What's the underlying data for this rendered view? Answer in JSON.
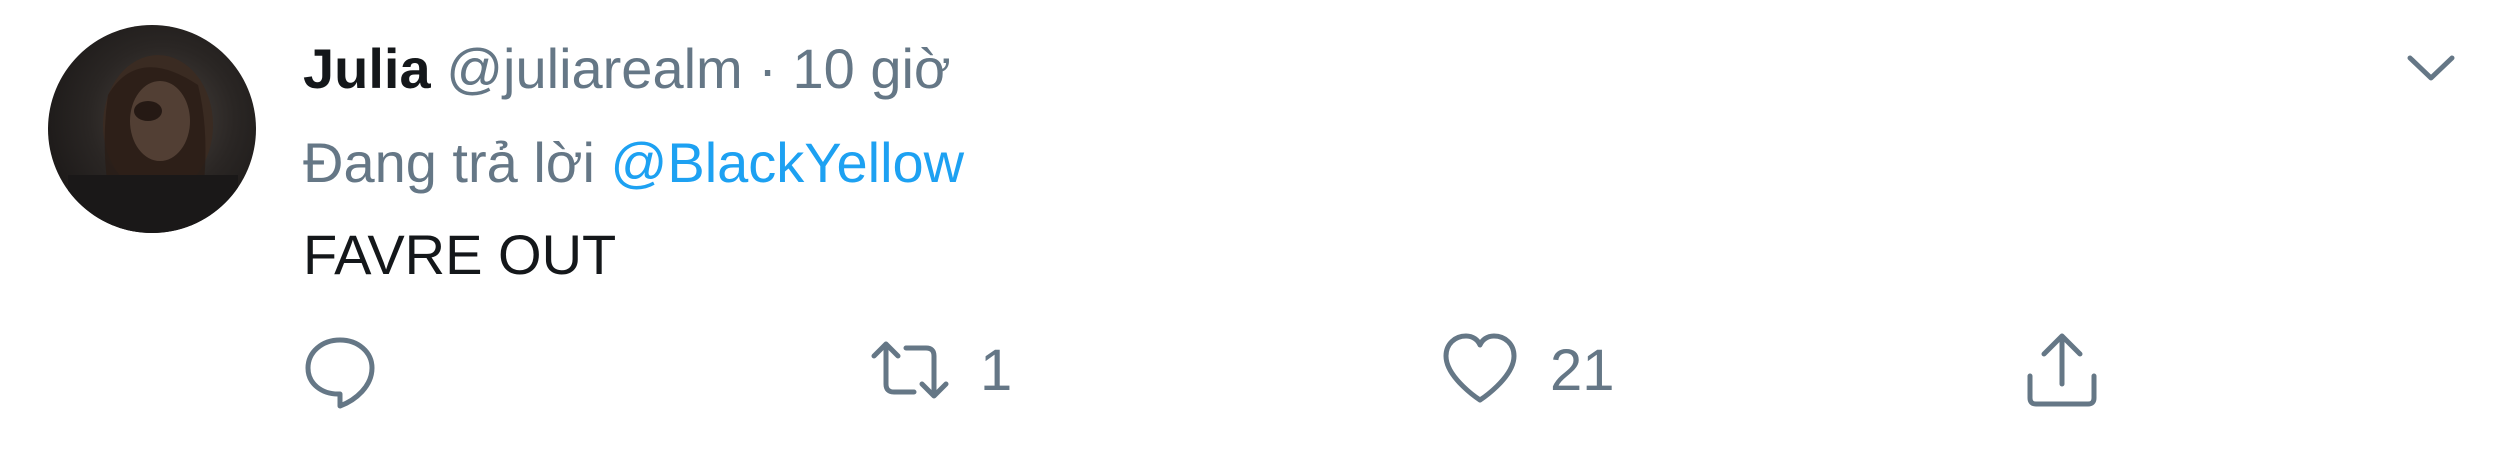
{
  "tweet": {
    "author": {
      "name": "Julia",
      "handle": "@juliarealm",
      "separator": "·",
      "time": "10 giờ"
    },
    "replying": {
      "prefix": "Đang trả lời",
      "mention": "@BlackYellow"
    },
    "text": "FAVRE OUT",
    "actions": {
      "reply": {
        "icon": "reply-icon"
      },
      "retweet": {
        "icon": "retweet-icon",
        "count": "1"
      },
      "like": {
        "icon": "heart-icon",
        "count": "21"
      },
      "share": {
        "icon": "share-icon"
      }
    },
    "menu_icon": "chevron-down-icon"
  },
  "colors": {
    "text": "#14171a",
    "secondary": "#657786",
    "link": "#1da1f2",
    "background": "#ffffff"
  }
}
